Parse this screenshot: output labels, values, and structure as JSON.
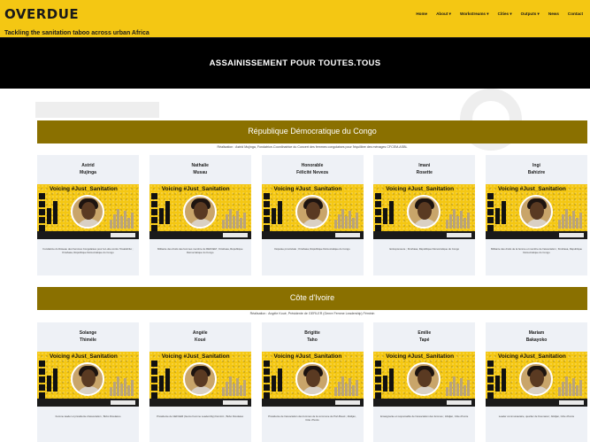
{
  "header": {
    "logo": "OVERDUE",
    "nav": [
      "Home",
      "About ▾",
      "Workstreams ▾",
      "Cities ▾",
      "Outputs ▾",
      "News",
      "Contact"
    ],
    "tagline": "Tackling the sanitation taboo across urban Africa"
  },
  "hero": {
    "title": "ASSAINISSEMENT POUR TOUTES.TOUS"
  },
  "poster_title": "Voicing #Just_Sanitation",
  "sections": [
    {
      "title": "République Démocratique du Congo",
      "credit": "Réalisation : Astrid Mujinga, Fondatrice-Coordinatrice du Concert des femmes congolaises pour l'équilibre des ménages CFCEM-ASBL",
      "people": [
        {
          "first": "Astrid",
          "last": "Mujinga",
          "desc": "Fondatrice du Réseau des Femmes Congolaises pour la Lutte contre l'Insalubrité ; Kinshasa, République Démocratique du Congo"
        },
        {
          "first": "Nathalie",
          "last": "Musau",
          "desc": "Militante des droits des femmes membre du REFCEM ; Kinshasa, République Démocratique du Congo"
        },
        {
          "first": "Honorable",
          "last": "Félicité Neveza",
          "desc": "Députée provinciale ; Kinshasa, République Démocratique du Congo"
        },
        {
          "first": "Imani",
          "last": "Rosette",
          "desc": "Entrepreneure ; Kinshasa, République Démocratique du Congo"
        },
        {
          "first": "Ingi",
          "last": "Bahizire",
          "desc": "Militante des droits de la femme et membre de l'association ; Kinshasa, République Démocratique du Congo"
        }
      ]
    },
    {
      "title": "Côte d'Ivoire",
      "credit": "Réalisation : Angèle Koué, Présidente de GEFILER (Genre Femme Leadership) Féminin",
      "people": [
        {
          "first": "Solange",
          "last": "Thiméle",
          "desc": "Femme leader et présidente d'association ; Bobo Dioulasso"
        },
        {
          "first": "Angèle",
          "last": "Koué",
          "desc": "Présidente de GEFILER (Genre Femme Leadership) Féminin ; Bobo Dioulasso"
        },
        {
          "first": "Brigitte",
          "last": "Taho",
          "desc": "Présidente de l'association des femmes de la commune de Port-Bouët ; Abidjan, Côte d'Ivoire"
        },
        {
          "first": "Emilie",
          "last": "Tapé",
          "desc": "Enseignante et responsable de l'association des femmes ; Abidjan, Côte d'Ivoire"
        },
        {
          "first": "Mariam",
          "last": "Bakayoko",
          "desc": "Leader communautaire, quartier de Koumassi ; Abidjan, Côte d'Ivoire"
        }
      ]
    }
  ],
  "colors": {
    "accent": "#f4c713",
    "section": "#8a7000",
    "hero": "#000000"
  }
}
